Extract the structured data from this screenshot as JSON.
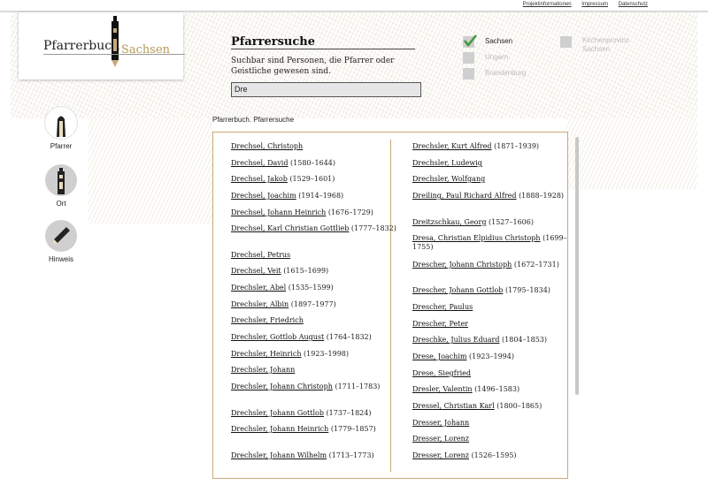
{
  "top_links": [
    "Projektinformationen",
    "Impressum",
    "Datenschutz"
  ],
  "logo": {
    "part1": "Pfarrerbuch",
    "part2": "Sachsen"
  },
  "search": {
    "title": "Pfarrersuche",
    "description": "Suchbar sind Personen, die Pfarrer oder Geistliche gewesen sind.",
    "value": "Dre"
  },
  "filters": [
    {
      "label": "Sachsen",
      "checked": true
    },
    {
      "label": "Ungarn",
      "checked": false
    },
    {
      "label": "Brandenburg",
      "checked": false
    },
    {
      "label": "Kirchenprovinz Sachsen",
      "checked": false
    }
  ],
  "breadcrumb": "Pfarrerbuch. Pfarrersuche",
  "nav": [
    {
      "label": "Pfarrer",
      "active": true
    },
    {
      "label": "Ort",
      "active": false
    },
    {
      "label": "Hinweis",
      "active": false
    }
  ],
  "results_left": [
    {
      "name": "Drechsel, Christoph",
      "dates": ""
    },
    {
      "name": "Drechsel, David",
      "dates": "(1580–1644)"
    },
    {
      "name": "Drechsel, Jakob",
      "dates": "(1529–1601)"
    },
    {
      "name": "Drechsel, Joachim",
      "dates": "(1914–1968)"
    },
    {
      "name": "Drechsel, Johann Heinrich",
      "dates": "(1676–1729)"
    },
    {
      "name": "Drechsel, Karl Christian Gottlieb",
      "dates": "(1777–1832)"
    },
    {
      "name": "Drechsel, Petrus",
      "dates": ""
    },
    {
      "name": "Drechsel, Veit",
      "dates": "(1615–1699)"
    },
    {
      "name": "Drechsler, Abel",
      "dates": "(1535–1599)"
    },
    {
      "name": "Drechsler, Albin",
      "dates": "(1897–1977)"
    },
    {
      "name": "Drechsler, Friedrich",
      "dates": ""
    },
    {
      "name": "Drechsler, Gottlob August",
      "dates": "(1764–1832)"
    },
    {
      "name": "Drechsler, Heinrich",
      "dates": "(1923–1998)"
    },
    {
      "name": "Drechsler, Johann",
      "dates": ""
    },
    {
      "name": "Drechsler, Johann Christoph",
      "dates": "(1711–1783)"
    },
    {
      "name": "Drechsler, Johann Gottlob",
      "dates": "(1737–1824)"
    },
    {
      "name": "Drechsler, Johann Heinrich",
      "dates": "(1779–1857)"
    },
    {
      "name": "Drechsler, Johann Wilhelm",
      "dates": "(1713–1773)"
    }
  ],
  "results_right": [
    {
      "name": "Drechsler, Kurt Alfred",
      "dates": "(1871–1939)"
    },
    {
      "name": "Drechsler, Ludewig",
      "dates": ""
    },
    {
      "name": "Drechsler, Wolfgang",
      "dates": ""
    },
    {
      "name": "Dreiling, Paul Richard Alfred",
      "dates": "(1888–1928)"
    },
    {
      "name": "Dreitzschkau, Georg",
      "dates": "(1527–1606)"
    },
    {
      "name": "Dresa, Christian Elpidius Christoph",
      "dates": "(1699–1755)"
    },
    {
      "name": "Drescher, Johann Christoph",
      "dates": "(1672–1731)"
    },
    {
      "name": "Drescher, Johann Gottlob",
      "dates": "(1795–1834)"
    },
    {
      "name": "Drescher, Paulus",
      "dates": ""
    },
    {
      "name": "Drescher, Peter",
      "dates": ""
    },
    {
      "name": "Dreschke, Julius Eduard",
      "dates": "(1804–1853)"
    },
    {
      "name": "Drese, Joachim",
      "dates": "(1923–1994)"
    },
    {
      "name": "Drese, Siegfried",
      "dates": ""
    },
    {
      "name": "Dresler, Valentin",
      "dates": "(1496–1583)"
    },
    {
      "name": "Dressel, Christian Karl",
      "dates": "(1800–1865)"
    },
    {
      "name": "Dresser, Johann",
      "dates": ""
    },
    {
      "name": "Dresser, Lorenz",
      "dates": ""
    },
    {
      "name": "Dresser, Lorenz",
      "dates": "(1526–1595)"
    }
  ],
  "colors": {
    "accent": "#c9a977",
    "gold": "#b59a5a",
    "check": "#3a9a3a"
  }
}
